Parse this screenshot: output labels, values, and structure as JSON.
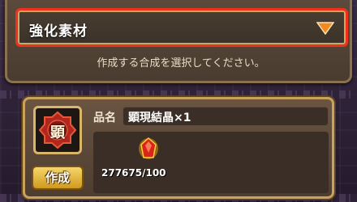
{
  "dropdown": {
    "selected": "強化素材"
  },
  "instruction": "作成する合成を選択してください。",
  "recipe": {
    "icon_char": "顕",
    "name_label": "品名",
    "name_value": "顕現結晶×1",
    "craft_label": "作成",
    "materials": [
      {
        "icon": "red-gem-icon",
        "count": "277675/100"
      }
    ]
  },
  "colors": {
    "highlight": "#f0301a",
    "accent_gold": "#d9b56a",
    "arrow": "#f08a20"
  }
}
